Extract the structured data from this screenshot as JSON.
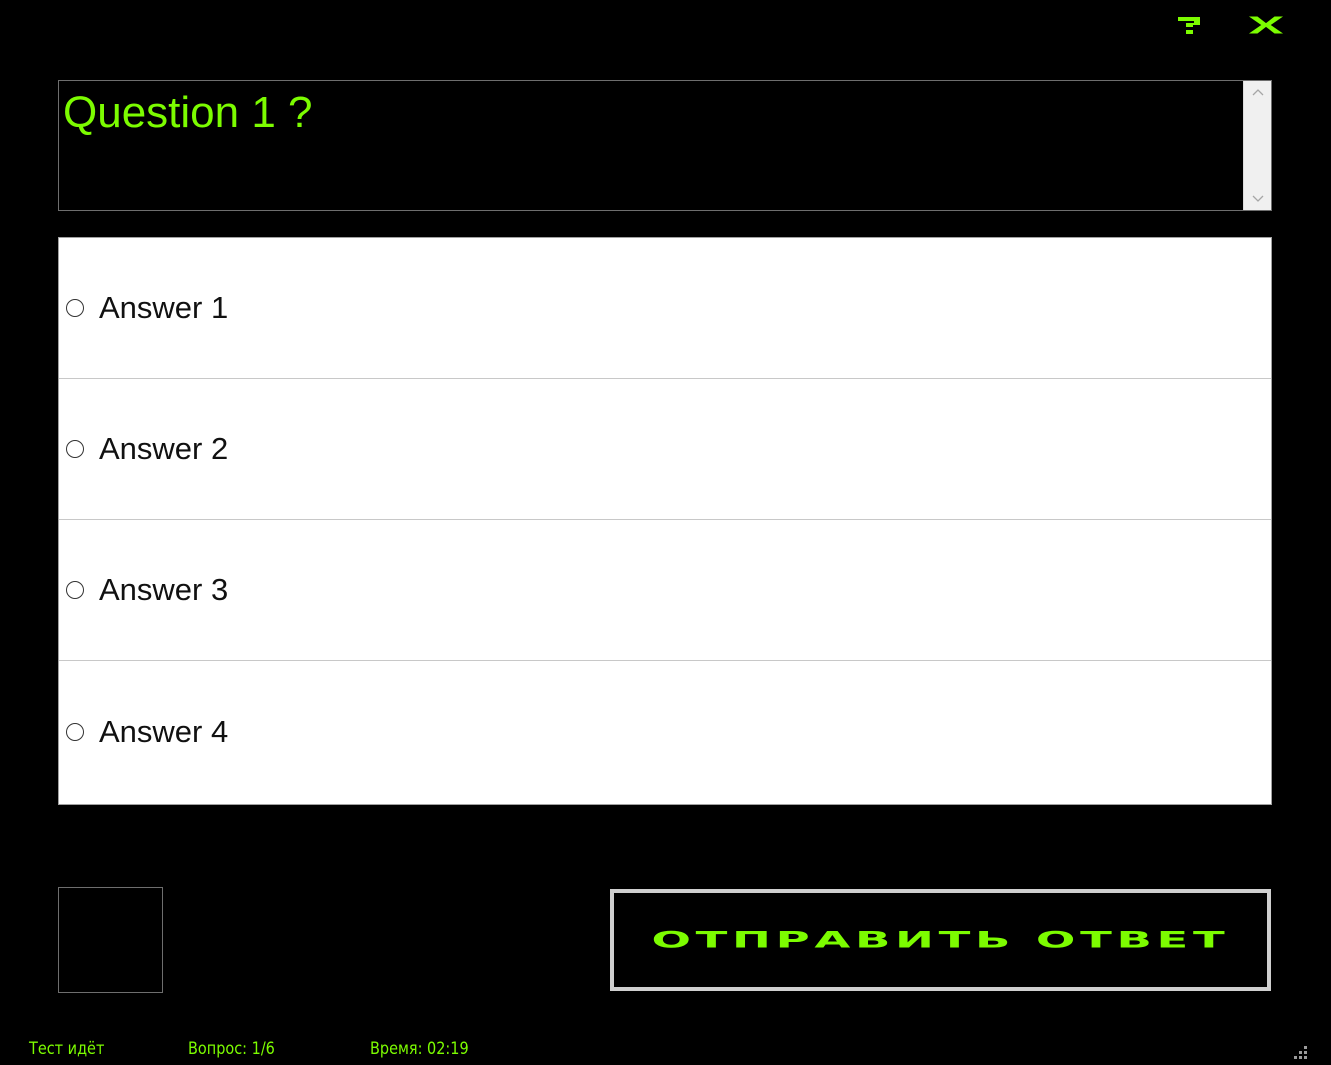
{
  "window": {
    "help_icon": "question-mark-icon",
    "close_icon": "close-x-icon",
    "accent_color": "#7cfc00"
  },
  "question": {
    "text": "Question 1 ?"
  },
  "answers": [
    {
      "label": "Answer 1",
      "selected": false
    },
    {
      "label": "Answer 2",
      "selected": false
    },
    {
      "label": "Answer 3",
      "selected": false
    },
    {
      "label": "Answer 4",
      "selected": false
    }
  ],
  "submit": {
    "label": "ОТПРАВИТЬ ОТВЕТ"
  },
  "status": {
    "state": "Тест идёт",
    "question_progress": "Вопрос: 1/6",
    "time": "Время: 02:19"
  }
}
